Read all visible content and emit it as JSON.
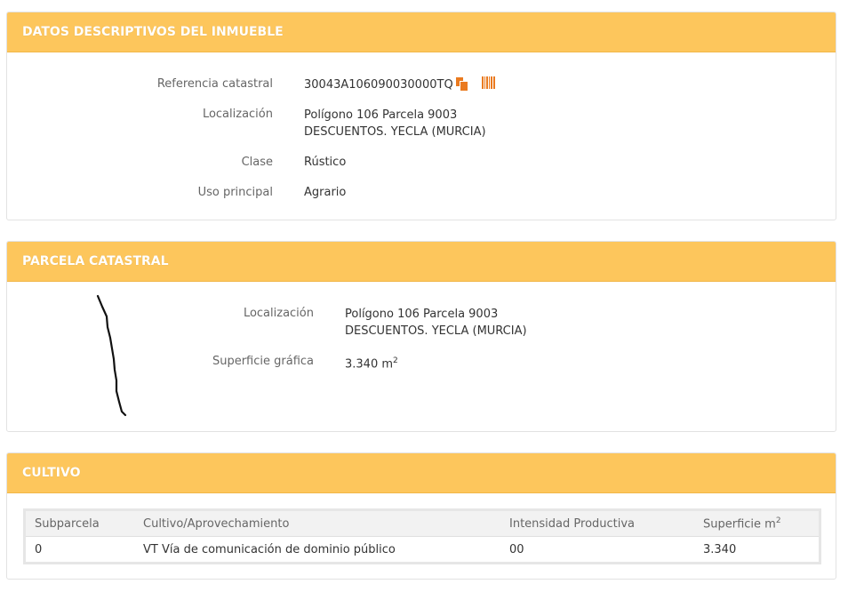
{
  "descriptivos": {
    "title": "DATOS DESCRIPTIVOS DEL INMUEBLE",
    "ref_label": "Referencia catastral",
    "ref_value": "30043A106090030000TQ",
    "loc_label": "Localización",
    "loc_line1": "Polígono 106 Parcela 9003",
    "loc_line2": "DESCUENTOS. YECLA (MURCIA)",
    "clase_label": "Clase",
    "clase_value": "Rústico",
    "uso_label": "Uso principal",
    "uso_value": "Agrario"
  },
  "parcela": {
    "title": "PARCELA CATASTRAL",
    "loc_label": "Localización",
    "loc_line1": "Polígono 106 Parcela 9003",
    "loc_line2": "DESCUENTOS. YECLA (MURCIA)",
    "sup_label": "Superficie gráfica",
    "sup_value": "3.340 m",
    "sup_unit_exp": "2"
  },
  "cultivo": {
    "title": "CULTIVO",
    "headers": [
      "Subparcela",
      "Cultivo/Aprovechamiento",
      "Intensidad Productiva",
      "Superficie m"
    ],
    "header_exp": "2",
    "rows": [
      [
        "0",
        "VT Vía de comunicación de dominio público",
        "00",
        "3.340"
      ]
    ]
  },
  "colors": {
    "header_bg": "#fdc65c",
    "icon_orange": "#ea7a1f"
  },
  "icons": [
    "copy-icon",
    "barcode-icon"
  ]
}
